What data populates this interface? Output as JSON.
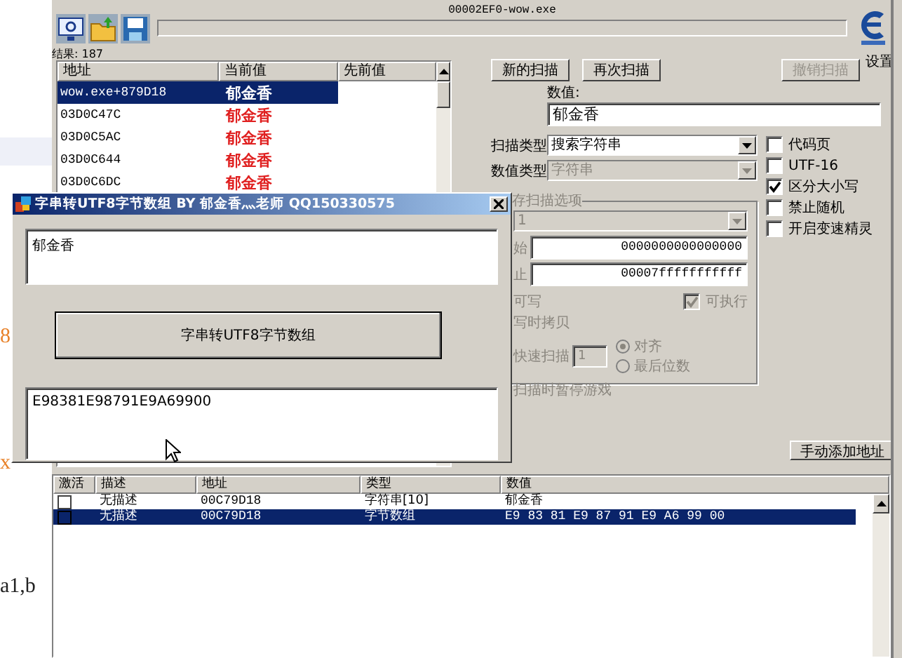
{
  "background_page": {
    "texts": [
      {
        "text": "8",
        "kind": "accent"
      },
      {
        "text": "x",
        "kind": "accent"
      },
      {
        "text": "a1,b",
        "kind": "plain"
      }
    ]
  },
  "main_window": {
    "title": "00002EF0-wow.exe",
    "settings_label": "设置",
    "results_label": "结果: 187",
    "results": {
      "columns": [
        "地址",
        "当前值",
        "先前值"
      ],
      "rows": [
        {
          "address": "wow.exe+879D18",
          "current": "郁金香",
          "selected": true
        },
        {
          "address": "03D0C47C",
          "current": "郁金香",
          "selected": false
        },
        {
          "address": "03D0C5AC",
          "current": "郁金香",
          "selected": false
        },
        {
          "address": "03D0C644",
          "current": "郁金香",
          "selected": false
        },
        {
          "address": "03D0C6DC",
          "current": "郁金香",
          "selected": false
        }
      ]
    },
    "buttons": [
      {
        "label": "新的扫描",
        "disabled": false
      },
      {
        "label": "再次扫描",
        "disabled": false
      },
      {
        "label": "撤销扫描",
        "disabled": true
      }
    ],
    "value_label": "数值:",
    "value": "郁金香",
    "scan_type": {
      "label": "扫描类型",
      "value": "搜索字符串",
      "disabled": false
    },
    "value_type": {
      "label": "数值类型",
      "value": "字符串",
      "disabled": true
    },
    "options": [
      {
        "label": "代码页",
        "checked": false
      },
      {
        "label": "UTF-16",
        "checked": false
      },
      {
        "label": "区分大小写",
        "checked": true
      },
      {
        "label": "禁止随机",
        "checked": false
      },
      {
        "label": "开启变速精灵",
        "checked": false
      }
    ],
    "memory_options": {
      "legend": "存扫描选项",
      "region": "1",
      "start_label": "始",
      "start": "0000000000000000",
      "stop_label": "止",
      "stop": "00007fffffffffff",
      "writable_label": "可写",
      "executable": {
        "label": "可执行",
        "checked": true
      },
      "copy_on_write_label": "写时拷贝",
      "fast_scan": {
        "label": "快速扫描",
        "value": "1"
      },
      "alignment": [
        {
          "label": "对齐",
          "selected": true
        },
        {
          "label": "最后位数",
          "selected": false
        }
      ],
      "pause_label": "扫描时暂停游戏"
    },
    "add_address_button": "手动添加地址",
    "address_list": {
      "columns": [
        "激活",
        "描述",
        "地址",
        "类型",
        "数值"
      ],
      "rows": [
        {
          "active": false,
          "description": "无描述",
          "address": "00C79D18",
          "type": "字符串[10]",
          "value": "郁金香",
          "selected": false
        },
        {
          "active": false,
          "description": "无描述",
          "address": "00C79D18",
          "type": "字节数组",
          "value": "E9 83 81 E9 87 91 E9 A6 99 00",
          "selected": true
        }
      ]
    }
  },
  "dialog": {
    "title": "字串转UTF8字节数组 BY 郁金香灬老师 QQ150330575",
    "input": "郁金香",
    "button": "字串转UTF8字节数组",
    "output": "E98381E98791E9A69900"
  }
}
